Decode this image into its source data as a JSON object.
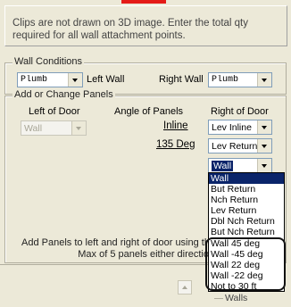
{
  "info": {
    "text": "Clips are not drawn on 3D image. Enter the total qty required for all wall attachment points."
  },
  "wall_conditions": {
    "group_label": "Wall Conditions",
    "left_wall_value": "Plumb",
    "left_wall_label": "Left Wall",
    "right_wall_label": "Right Wall",
    "right_wall_value": "Plumb"
  },
  "panels": {
    "group_label": "Add or Change Panels",
    "left_of_door_label": "Left of Door",
    "angle_label": "Angle of Panels",
    "right_of_door_label": "Right of Door",
    "left_value": "Wall",
    "angle_inline": "Inline",
    "angle_135": "135 Deg",
    "right_value_1": "Lev Inline",
    "right_value_2": "Lev Return",
    "right_value_3": "Wall"
  },
  "dropdown": {
    "items": [
      "Wall",
      "But Return",
      "Nch Return",
      "Lev Return",
      "Dbl Nch Return",
      "But Nch Return",
      "Wall  45 deg",
      "Wall -45 deg",
      "Wall  22 deg",
      "Wall -22 deg",
      "Not to 30 ft"
    ],
    "selected_index": 0
  },
  "footer": {
    "line1": "Add Panels to left and right of door using the",
    "line2": "Max of 5 panels either directio"
  },
  "walls_partial": "Walls",
  "colors": {
    "accent": "#e41b17",
    "selection": "#0a246a",
    "background": "#ece9d8"
  }
}
